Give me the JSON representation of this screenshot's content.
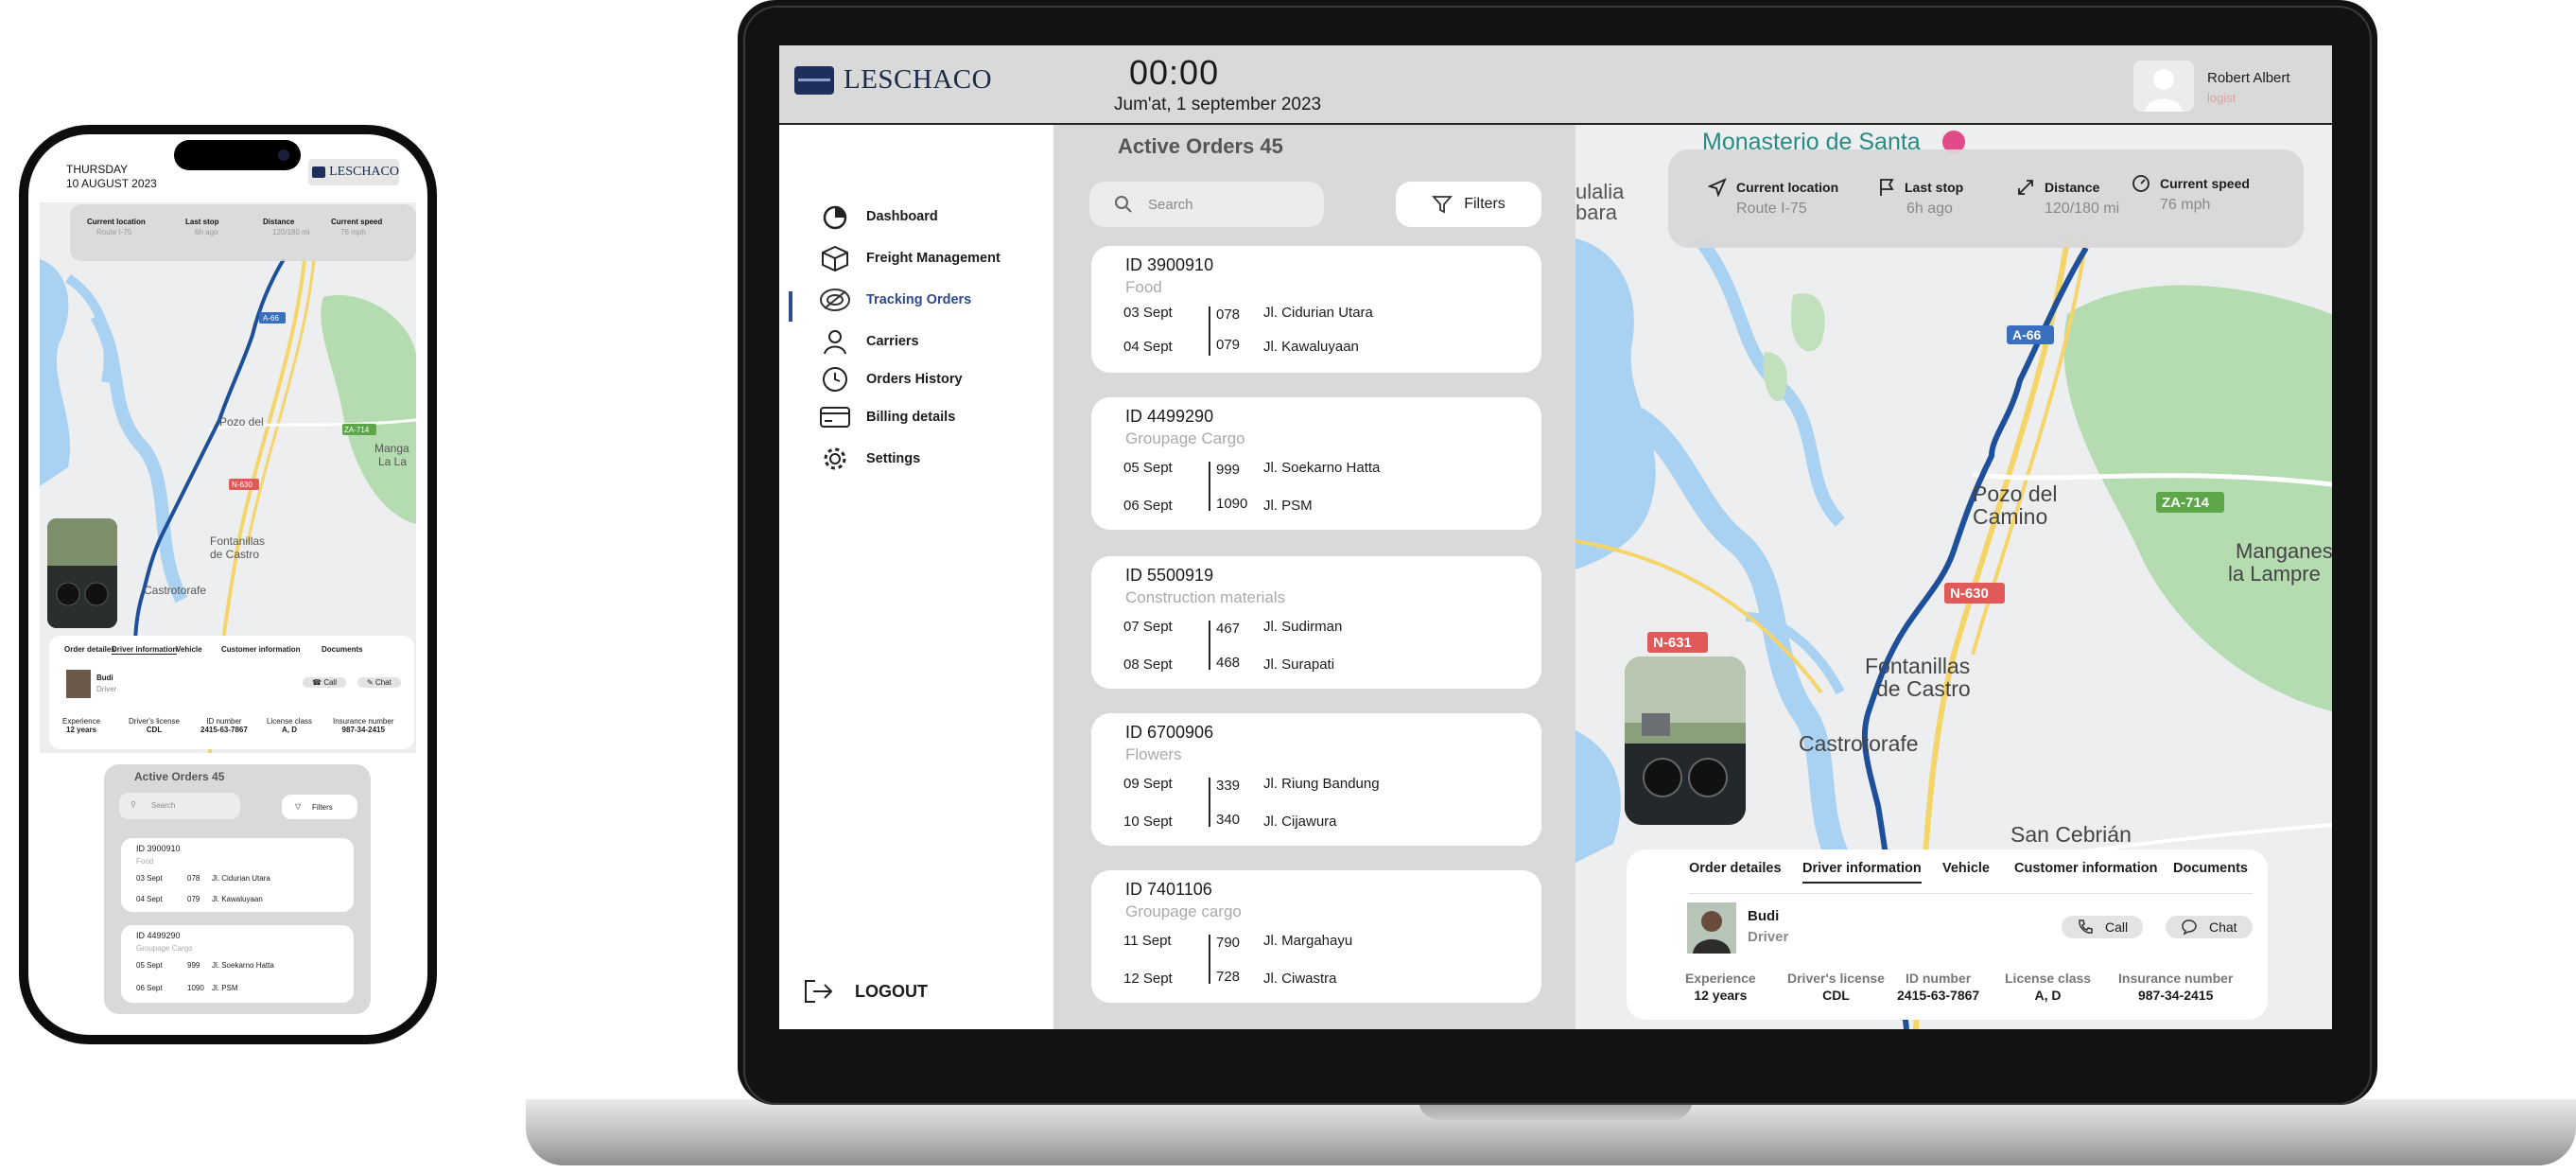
{
  "brand": {
    "logo_text": "LESCHACO"
  },
  "header": {
    "time": "00:00",
    "date": "Jum'at, 1 september 2023"
  },
  "user": {
    "name": "Robert Albert",
    "role": "logist"
  },
  "sidebar": {
    "items": [
      {
        "label": "Dashboard",
        "icon": "dashboard-icon"
      },
      {
        "label": "Freight Management",
        "icon": "box-icon"
      },
      {
        "label": "Tracking Orders",
        "icon": "tracking-icon",
        "active": true
      },
      {
        "label": "Carriers",
        "icon": "person-icon"
      },
      {
        "label": "Orders History",
        "icon": "clock-icon"
      },
      {
        "label": "Billing details",
        "icon": "card-icon"
      },
      {
        "label": "Settings",
        "icon": "gear-icon"
      }
    ],
    "logout": "LOGOUT"
  },
  "orders": {
    "title": "Active Orders 45",
    "search_placeholder": "Search",
    "filters_label": "Filters",
    "list": [
      {
        "id": "ID 3900910",
        "category": "Food",
        "rows": [
          {
            "date": "03 Sept",
            "num": "078",
            "street": "Jl.  Cidurian Utara"
          },
          {
            "date": "04 Sept",
            "num": "079",
            "street": "Jl.  Kawaluyaan"
          }
        ]
      },
      {
        "id": "ID 4499290",
        "category": "Groupage Cargo",
        "rows": [
          {
            "date": "05 Sept",
            "num": "999",
            "street": "Jl.  Soekarno Hatta"
          },
          {
            "date": "06 Sept",
            "num": "1090",
            "street": "Jl.  PSM"
          }
        ]
      },
      {
        "id": "ID 5500919",
        "category": "Construction materials",
        "rows": [
          {
            "date": "07 Sept",
            "num": "467",
            "street": "Jl.  Sudirman"
          },
          {
            "date": "08 Sept",
            "num": "468",
            "street": "Jl.  Surapati"
          }
        ]
      },
      {
        "id": "ID 6700906",
        "category": "Flowers",
        "rows": [
          {
            "date": "09 Sept",
            "num": "339",
            "street": "Jl.  Riung Bandung"
          },
          {
            "date": "10 Sept",
            "num": "340",
            "street": "Jl.  Cijawura"
          }
        ]
      },
      {
        "id": "ID 7401106",
        "category": "Groupage cargo",
        "rows": [
          {
            "date": "11 Sept",
            "num": "790",
            "street": "Jl.  Margahayu"
          },
          {
            "date": "12 Sept",
            "num": "728",
            "street": "Jl.  Ciwastra"
          }
        ]
      }
    ]
  },
  "tracking": {
    "current_location": {
      "label": "Current location",
      "value": "Route I-75"
    },
    "last_stop": {
      "label": "Last stop",
      "value": "6h ago"
    },
    "distance": {
      "label": "Distance",
      "value": "120/180 mi"
    },
    "current_speed": {
      "label": "Current speed",
      "value": "76 mph"
    }
  },
  "map_labels": {
    "monastery": "Monasterio de Santa",
    "ulalia": "ulalia",
    "bara": "bara",
    "a66": "A-66",
    "pozo": "Pozo del",
    "camino": "Camino",
    "za714": "ZA-714",
    "manganeses": "Manganes",
    "la_lampre": "la Lampre",
    "n630": "N-630",
    "n631": "N-631",
    "fontanillas": "Fontanillas",
    "de_castro": "de Castro",
    "castrotorafe": "Castrotorafe",
    "san_cebrian": "San Cebrián",
    "mangas": "Manga",
    "la_la": "La La"
  },
  "driver_panel": {
    "tabs": [
      "Order detailes",
      "Driver information",
      "Vehicle",
      "Customer information",
      "Documents"
    ],
    "active_tab": "Driver information",
    "name": "Budi",
    "role": "Driver",
    "call": "Call",
    "chat": "Chat",
    "fields": [
      {
        "label": "Experience",
        "value": "12 years"
      },
      {
        "label": "Driver's license",
        "value": "CDL"
      },
      {
        "label": "ID number",
        "value": "2415-63-7867"
      },
      {
        "label": "License class",
        "value": "A, D"
      },
      {
        "label": "Insurance number",
        "value": "987-34-2415"
      }
    ]
  },
  "phone": {
    "day": "THURSDAY",
    "date": "10 AUGUST 2023"
  },
  "colors": {
    "route": "#1e4f9a",
    "accent": "#2e4a8e",
    "water": "#a9d1f2",
    "park": "#b5dbb1",
    "road": "#f5d56a"
  }
}
